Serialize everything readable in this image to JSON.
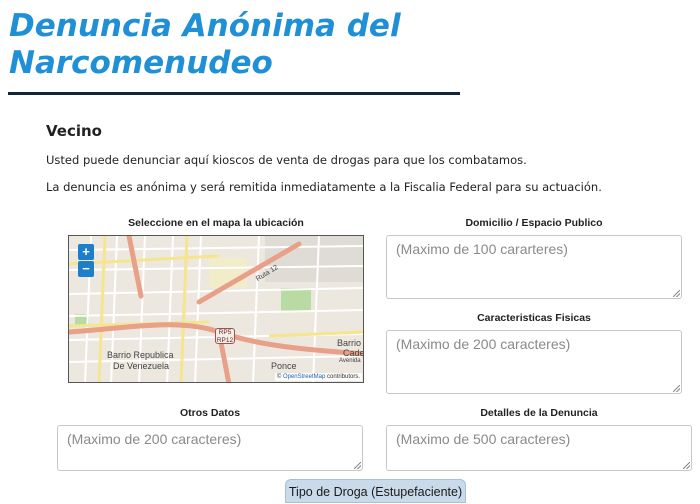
{
  "page": {
    "title": "Denuncia Anónima del Narcomenudeo",
    "section_heading": "Vecino",
    "intro_1": "Usted puede denunciar aquí kioscos de venta de drogas para que los combatamos.",
    "intro_2": "La denuncia es anónima y será remitida inmediatamente a la Fiscalia Federal para su actuación."
  },
  "map": {
    "label": "Seleccione en el mapa la ubicación",
    "zoom_in": "+",
    "zoom_out": "−",
    "places": {
      "barrio_republica": "Barrio Republica",
      "de_venezuela": "De Venezuela",
      "ponce": "Ponce",
      "barrio": "Barrio",
      "cade": "Cade",
      "avenida": "Avenida",
      "route": "Ruta 12",
      "shield_line_1": "RP5",
      "shield_line_2": "RP12"
    },
    "attribution_prefix": "©",
    "attribution_link": "OpenStreetMap",
    "attribution_suffix": "contributors."
  },
  "fields": {
    "domicilio": {
      "label": "Domicilio / Espacio Publico",
      "placeholder": "(Maximo de 100 cararteres)"
    },
    "caracteristicas": {
      "label": "Caracteristicas Fisicas",
      "placeholder": "(Maximo de 200 caracteres)"
    },
    "otros": {
      "label": "Otros Datos",
      "placeholder": "(Maximo de 200 caracteres)"
    },
    "detalles": {
      "label": "Detalles de la Denuncia",
      "placeholder": "(Maximo de 500 caracteres)"
    }
  },
  "drug_button": {
    "label": "Tipo de Droga (Estupefaciente)"
  },
  "colors": {
    "title": "#1f8fd6",
    "rule": "#12263a",
    "button": "#c9dbeb",
    "zoom": "#1e7ec9"
  },
  "icons": [
    "zoom-in-icon",
    "zoom-out-icon",
    "resize-grip-icon"
  ]
}
